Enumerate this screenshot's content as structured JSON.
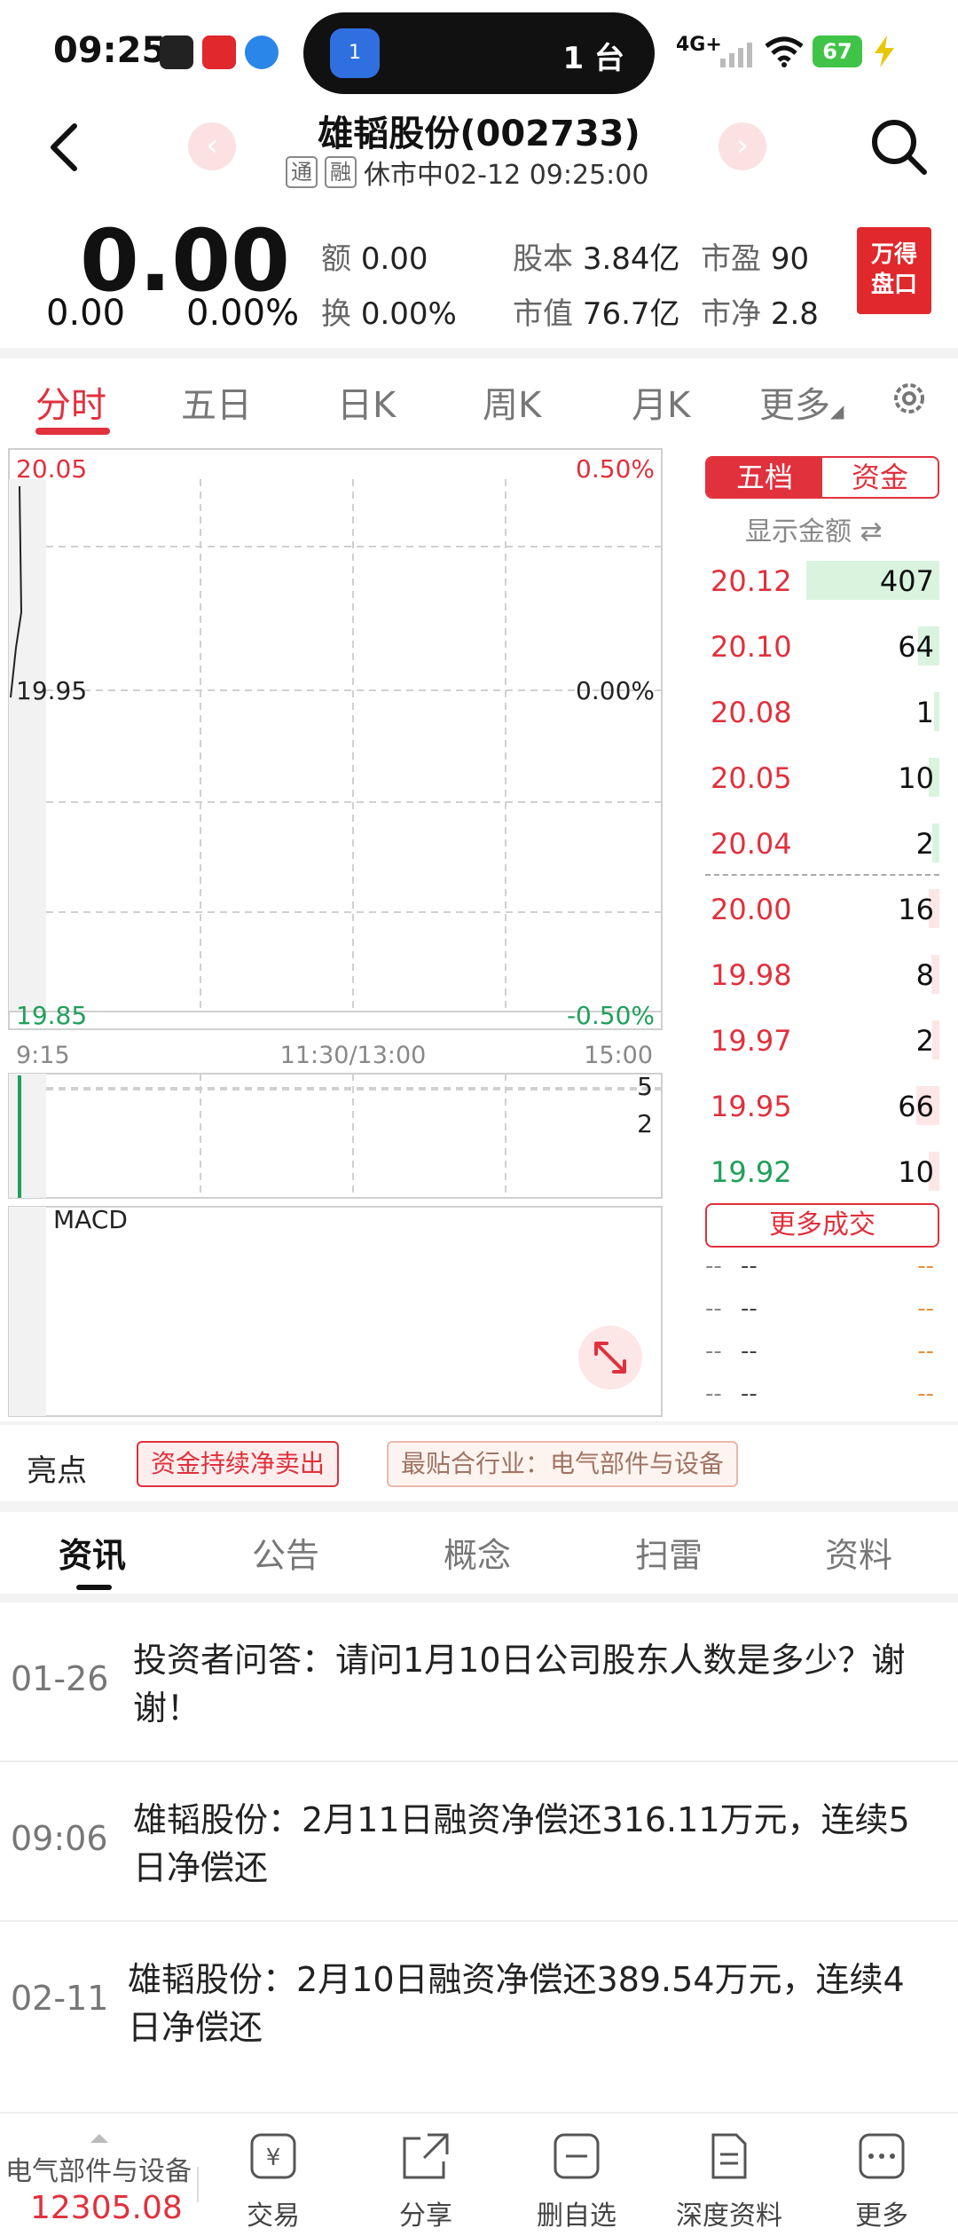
{
  "status_bar": {
    "time": "09:25",
    "island_text": "1 台",
    "island_badge": "1",
    "signal_text": "4G+",
    "battery": "67"
  },
  "header": {
    "title": "雄韬股份(002733)",
    "tag_tong": "通",
    "tag_rong": "融",
    "status": "休市中02-12 09:25:00",
    "prev_icon": "chevron-left-circle",
    "next_icon": "chevron-right-circle"
  },
  "quote": {
    "price": "0.00",
    "change": "0.00",
    "change_pct": "0.00%",
    "stats": [
      {
        "k": "额",
        "v": "0.00"
      },
      {
        "k": "股本",
        "v": "3.84亿"
      },
      {
        "k": "市盈",
        "v": "90"
      },
      {
        "k": "换",
        "v": "0.00%"
      },
      {
        "k": "市值",
        "v": "76.7亿"
      },
      {
        "k": "市净",
        "v": "2.8"
      }
    ],
    "logo_line1": "万得",
    "logo_line2": "盘口"
  },
  "chart_tabs": [
    "分时",
    "五日",
    "日K",
    "周K",
    "月K",
    "更多"
  ],
  "chart": {
    "price_high": "20.05",
    "price_mid": "19.95",
    "price_low": "19.85",
    "pct_high": "0.50%",
    "pct_mid": "0.00%",
    "pct_low": "-0.50%",
    "time_start": "9:15",
    "time_mid": "11:30/13:00",
    "time_end": "15:00",
    "vol_high": "5",
    "vol_low": "2",
    "macd_label": "MACD"
  },
  "order_book": {
    "tab_five": "五档",
    "tab_fund": "资金",
    "toggle_label": "显示金额",
    "asks": [
      {
        "price": "20.12",
        "vol": "407",
        "color": "red",
        "fill": 1.0
      },
      {
        "price": "20.10",
        "vol": "64",
        "color": "red",
        "fill": 0.16
      },
      {
        "price": "20.08",
        "vol": "1",
        "color": "red",
        "fill": 0.04
      },
      {
        "price": "20.05",
        "vol": "10",
        "color": "red",
        "fill": 0.08
      },
      {
        "price": "20.04",
        "vol": "2",
        "color": "red",
        "fill": 0.05
      }
    ],
    "bids": [
      {
        "price": "20.00",
        "vol": "16",
        "color": "red",
        "fill": 0.08
      },
      {
        "price": "19.98",
        "vol": "8",
        "color": "red",
        "fill": 0.06
      },
      {
        "price": "19.97",
        "vol": "2",
        "color": "red",
        "fill": 0.05
      },
      {
        "price": "19.95",
        "vol": "66",
        "color": "red",
        "fill": 0.17
      },
      {
        "price": "19.92",
        "vol": "10",
        "color": "green",
        "fill": 0.08
      }
    ],
    "more_trades": "更多成交",
    "trades": [
      {
        "a": "--",
        "b": "--",
        "c": "--"
      },
      {
        "a": "--",
        "b": "--",
        "c": "--"
      },
      {
        "a": "--",
        "b": "--",
        "c": "--"
      },
      {
        "a": "--",
        "b": "--",
        "c": "--"
      }
    ]
  },
  "highlights": {
    "label": "亮点",
    "tag1": "资金持续净卖出",
    "tag2": "最贴合行业：电气部件与设备"
  },
  "news_tabs": [
    "资讯",
    "公告",
    "概念",
    "扫雷",
    "资料"
  ],
  "news": [
    {
      "date": "01-26",
      "title": "投资者问答：请问1月10日公司股东人数是多少？谢谢！",
      "highlight": true
    },
    {
      "date": "09:06",
      "title": "雄韬股份：2月11日融资净偿还316.11万元，连续5日净偿还",
      "highlight": false
    },
    {
      "date": "02-11",
      "title": "雄韬股份：2月10日融资净偿还389.54万元，连续4日净偿还",
      "highlight": false
    }
  ],
  "bottom_bar": {
    "index_name": "电气部件与设备",
    "index_value": "12305.08",
    "items": [
      "交易",
      "分享",
      "删自选",
      "深度资料",
      "更多"
    ]
  },
  "colors": {
    "up": "#e0313d",
    "down": "#1fa05a",
    "accent": "#e0313d"
  }
}
